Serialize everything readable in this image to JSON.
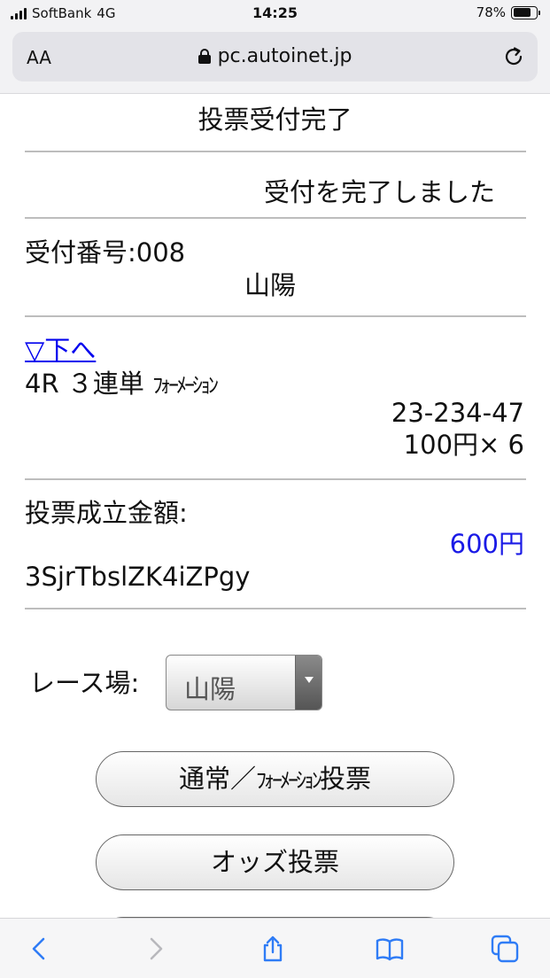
{
  "status_bar": {
    "carrier": "SoftBank",
    "network": "4G",
    "time": "14:25",
    "battery": "78%",
    "battery_level": 0.78
  },
  "address_bar": {
    "text_size_label": "AA",
    "url": "pc.autoinet.jp"
  },
  "page": {
    "title": "投票受付完了",
    "message": "受付を完了しました",
    "receipt_number": "受付番号:008",
    "venue": "山陽",
    "down_link": "▽下へ",
    "race": "4R",
    "bet_type": "３連単",
    "bet_method": "ﾌｫｰﾒｰｼｮﾝ",
    "combination": "23-234-47",
    "stake": "100円× 6",
    "total_label": "投票成立金額:",
    "total_amount": "600円",
    "confirmation_code": "3SjrTbslZK4iZPgy",
    "venue_select_label": "レース場:",
    "venue_selected": "山陽",
    "buttons": {
      "normal_formation_prefix": "通常／",
      "normal_formation_kana": "ﾌｫｰﾒｰｼｮﾝ",
      "normal_formation_suffix": "投票",
      "odds": "オッズ投票"
    }
  },
  "colors": {
    "link": "#0000ee",
    "amount": "#1a1ae6",
    "toolbar_icon": "#2f7cf6",
    "toolbar_icon_disabled": "#b8b8bd"
  },
  "toolbar": {
    "icons": [
      "back-icon",
      "forward-icon",
      "share-icon",
      "bookmarks-icon",
      "tabs-icon"
    ]
  }
}
